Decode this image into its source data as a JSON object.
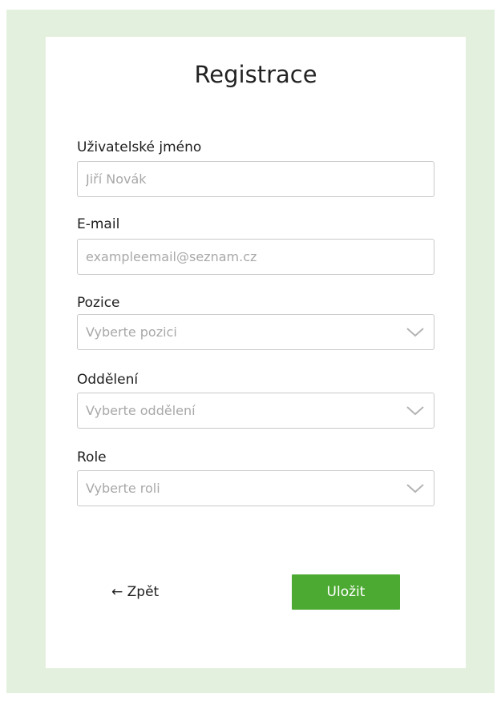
{
  "form": {
    "title": "Registrace",
    "username": {
      "label": "Uživatelské jméno",
      "placeholder": "Jiří Novák"
    },
    "email": {
      "label": "E-mail",
      "placeholder": "exampleemail@seznam.cz"
    },
    "position": {
      "label": "Pozice",
      "value": "Vyberte pozici"
    },
    "department": {
      "label": "Oddělení",
      "value": "Vyberte oddělení"
    },
    "role": {
      "label": "Role",
      "value": "Vyberte roli"
    },
    "back_label": "← Zpět",
    "save_label": "Uložit"
  },
  "icons": {
    "dropdown": "chevron-down-icon"
  },
  "colors": {
    "background": "#e4f0de",
    "card": "#ffffff",
    "primary_button": "#4caa32",
    "border": "#c9c9c9",
    "placeholder": "#a8a8a8"
  }
}
